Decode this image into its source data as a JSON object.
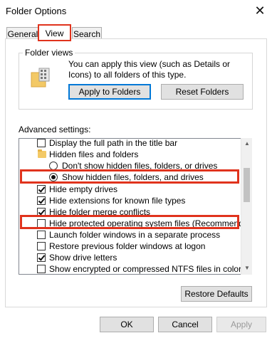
{
  "window": {
    "title": "Folder Options",
    "close_glyph": "✕"
  },
  "tabs": [
    {
      "label": "General",
      "active": false
    },
    {
      "label": "View",
      "active": true
    },
    {
      "label": "Search",
      "active": false
    }
  ],
  "folder_views": {
    "label": "Folder views",
    "description": "You can apply this view (such as Details or Icons) to all folders of this type.",
    "icon": "folder-view-icon",
    "apply_button": "Apply to Folders",
    "reset_button": "Reset Folders"
  },
  "advanced": {
    "label": "Advanced settings:",
    "items": [
      {
        "type": "checkbox",
        "checked": false,
        "label": "Display the full path in the title bar"
      },
      {
        "type": "folder",
        "label": "Hidden files and folders"
      },
      {
        "type": "radio",
        "checked": false,
        "label": "Don't show hidden files, folders, or drives"
      },
      {
        "type": "radio",
        "checked": true,
        "label": "Show hidden files, folders, and drives"
      },
      {
        "type": "checkbox",
        "checked": true,
        "label": "Hide empty drives"
      },
      {
        "type": "checkbox",
        "checked": true,
        "label": "Hide extensions for known file types"
      },
      {
        "type": "checkbox",
        "checked": true,
        "label": "Hide folder merge conflicts"
      },
      {
        "type": "checkbox",
        "checked": false,
        "label": "Hide protected operating system files (Recommended)"
      },
      {
        "type": "checkbox",
        "checked": false,
        "label": "Launch folder windows in a separate process"
      },
      {
        "type": "checkbox",
        "checked": false,
        "label": "Restore previous folder windows at logon"
      },
      {
        "type": "checkbox",
        "checked": true,
        "label": "Show drive letters"
      },
      {
        "type": "checkbox",
        "checked": false,
        "label": "Show encrypted or compressed NTFS files in color"
      }
    ]
  },
  "restore_defaults": "Restore Defaults",
  "footer": {
    "ok": "OK",
    "cancel": "Cancel",
    "apply": "Apply"
  },
  "colors": {
    "highlight": "#e0331d",
    "focus": "#0078d7"
  }
}
